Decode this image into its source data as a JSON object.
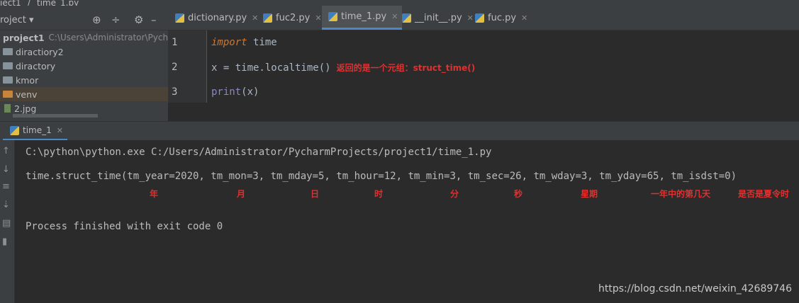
{
  "breadcrumb": {
    "project": "ject1",
    "file": "time_1.py"
  },
  "project_panel": {
    "title": "roject",
    "tools": [
      "target-icon",
      "collapse-icon",
      "gear-icon",
      "minimize-icon"
    ],
    "root": {
      "name": "project1",
      "path": "C:\\Users\\Administrator\\Pycharm"
    },
    "items": [
      {
        "name": "diractiory2",
        "type": "folder"
      },
      {
        "name": "diractory",
        "type": "folder"
      },
      {
        "name": "kmor",
        "type": "folder"
      },
      {
        "name": "venv",
        "type": "folder-excluded"
      },
      {
        "name": "2.jpg",
        "type": "image"
      }
    ]
  },
  "editor": {
    "tabs": [
      {
        "label": "dictionary.py",
        "active": false
      },
      {
        "label": "fuc2.py",
        "active": false
      },
      {
        "label": "time_1.py",
        "active": true
      },
      {
        "label": "__init__.py",
        "active": false
      },
      {
        "label": "fuc.py",
        "active": false
      }
    ],
    "lines": [
      {
        "num": "1",
        "kw": "import",
        "rest": " time"
      },
      {
        "num": "2",
        "code": "x = time.localtime()",
        "note": "返回的是一个元组：struct_time()"
      },
      {
        "num": "3",
        "builtin": "print",
        "rest": "(x)"
      }
    ]
  },
  "run": {
    "tab_label": "time_1",
    "command": "C:\\python\\python.exe C:/Users/Administrator/PycharmProjects/project1/time_1.py",
    "output": "time.struct_time(tm_year=2020, tm_mon=3, tm_mday=5, tm_hour=12, tm_min=3, tm_sec=26, tm_wday=3, tm_yday=65, tm_isdst=0)",
    "annotations": [
      "年",
      "月",
      "日",
      "时",
      "分",
      "秒",
      "星期",
      "一年中的第几天",
      "是否是夏令时"
    ],
    "exit_message": "Process finished with exit code 0"
  },
  "watermark": "https://blog.csdn.net/weixin_42689746",
  "colors": {
    "accent": "#4a88c7",
    "note": "#e03030",
    "keyword": "#cc7832"
  }
}
